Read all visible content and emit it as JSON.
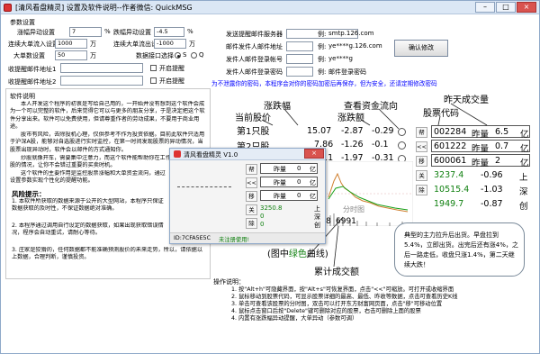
{
  "window": {
    "title": "[清风看盘精灵] 设置及软件说明--作者微信: QuickMSG",
    "min": "–",
    "max": "□",
    "close": "×"
  },
  "params": {
    "heading": "参数设置",
    "rows": [
      {
        "label": "涨幅异动设置",
        "value": "7",
        "unit": "%"
      },
      {
        "label": "连续大单流入设置",
        "value": "1000",
        "unit": "万"
      },
      {
        "label": "大单数设置",
        "value": "50",
        "unit": "万"
      }
    ],
    "fall_label": "跌幅异动设置",
    "fall_value": "-4.5",
    "fall_unit": "%",
    "outflow_label": "连续大单流出设置",
    "outflow_value": "-1000",
    "outflow_unit": "万",
    "source_label": "数据接口选择",
    "source_opt1": "S",
    "source_opt2": "Q",
    "mail1_label": "收提醒邮件地址1",
    "mail2_label": "收提醒邮件地址2",
    "alert_label": "开启提醒"
  },
  "mail": {
    "server_label": "发送提醒邮件服务器",
    "server_example_label": "例:",
    "server_example": "smtp.126.com",
    "sender_label": "邮件发件人邮件地址",
    "sender_example_label": "例:",
    "sender_example": "ye****g.126.com",
    "account_label": "发件人邮件登录帐号",
    "account_example_label": "例:",
    "account_example": "ye****g",
    "password_label": "发件人邮件登录密码",
    "password_example_label": "例:",
    "password_example": "邮件登录密码",
    "save_button": "确认修改",
    "notice": "为不泄露你的密码，本程序会对你的密码加密后再保存，但为安全，还请定期修改密码"
  },
  "manual": {
    "heading": "软件说明",
    "para1": "本人开发这个程序的初衷是写给自己用的，一开始并没有想到这个软件会成为一个可以完整的软件，后来觉得它可以与更多的朋友分享，于是决定把这个软件分享出来。软件可以免费使用，但请尊重作者的劳动成果，不要用于商业用途。",
    "para2": "股市有风险，去除投机心理，仅供参考不作为投资依据。目前此软件只适用于沪深A股，能够对自选股进行实时监控，在第一时间发现股票的异动情况，当股票出现异动时，软件会以邮件的方式通知你。",
    "para3": "炒股就像开车，需要集中注意力，而这个软件能帮助你在工作之余了解自选股的情况，让你不会错过重要的买卖时机。",
    "para4": "这个软件的主要作用是监控股票涨幅和大单资金流向，通过设置参数实现个性化的提醒功能。",
    "tips_heading": "风险提示：",
    "tips": [
      "1. 本软件所获取的数据来源于公开的大型网站，本程序只保证数据获取的及时性，不保证数据绝对准确。",
      "2. 本程序通过调用自行设定的数据获取，如果出现获取错误情况，程序会自动重试，请耐心等待。",
      "3. 庄家是狡猾的，任何数据都不能准确预测股价的未来走势，所以，请依据以上数据，合理判断，谨慎投资。"
    ]
  },
  "annotations": {
    "rise": "涨跌幅",
    "price": "当前股价",
    "fund_flow": "查看资金流向",
    "rise_amount": "涨跌额",
    "prev_vol": "昨天成交量",
    "code": "股票代码",
    "buy1": "第1只股",
    "buy2": "第2只股",
    "chart_hint": "分时图",
    "green_line": "(图中",
    "green_word": "绿色",
    "green_tail": "曲线)",
    "cum_vol": "累计成交额",
    "price_label_a": "5988",
    "price_label_b": "6991"
  },
  "left_stocks": [
    {
      "price": "15.07",
      "rise": "-2.87",
      "amount": "-0.29"
    },
    {
      "price": "7.86",
      "rise": "-1.26",
      "amount": "-0.1"
    },
    {
      "price": "8.11",
      "rise": "-1.97",
      "amount": "-0.31"
    }
  ],
  "side_buttons": [
    "帮",
    "<<",
    "移",
    "关",
    "除"
  ],
  "right_stocks": [
    {
      "code": "002284",
      "vol_label": "昨量",
      "vol": "6.5",
      "unit": "亿"
    },
    {
      "code": "601222",
      "vol_label": "昨量",
      "vol": "0.7",
      "unit": "亿"
    },
    {
      "code": "600061",
      "vol_label": "昨量",
      "vol": "2",
      "unit": "亿"
    }
  ],
  "index_rows": [
    {
      "value": "3237.4",
      "change": "-0.96",
      "name": "上"
    },
    {
      "value": "10515.4",
      "change": "-1.03",
      "name": "深"
    },
    {
      "value": "1949.7",
      "change": "-0.87",
      "name": "创"
    }
  ],
  "popup": {
    "title": "清风看盘精灵 V1.0",
    "rows": [
      {
        "label": "昨量",
        "value": "0",
        "unit": "亿"
      },
      {
        "label": "昨量",
        "value": "0",
        "unit": "亿"
      },
      {
        "label": "昨量",
        "value": "0",
        "unit": "亿"
      }
    ],
    "buttons": [
      "帮",
      "<<",
      "移",
      "关",
      "除"
    ],
    "index_vals": [
      "3250.8",
      "0",
      "0"
    ],
    "index_names": [
      "上",
      "深",
      "创"
    ],
    "id_label": "ID:7CFA5E5C",
    "unregistered": "未注册使用!"
  },
  "bubble": {
    "text": "典型的主力拉升后出货。早盘拉到5.4%，立即出货。出完后还有涨4%，之后一路走低，收盘只涨1.4%，第二天继续大跌！"
  },
  "operations": {
    "heading": "操作说明：",
    "lines": [
      "1. 按\"Alt+h\"可隐藏界面，按\"Alt+s\"可恢复界面，点击\"<<\"可缩放。可打开或收缩界面",
      "2. 鼠标移动到股票代码，可显示股票详细的最高、最低、昨收等数据，点击可查看历史K线",
      "3. 单击可查看该股票的分时图，双击可以打开东方财富网页面，点击\"移\"可移动位置",
      "4. 鼠标点击窗口后按\"Delete\"键可删除对应的股票，右击可删除上面的股票",
      "4. 内置有涨跌幅异动提醒，大单异动（参数可调）"
    ]
  },
  "colors": {
    "accent_blue": "#0000ff",
    "alert_red": "#e00000",
    "rise_green": "#108010",
    "titlebar": "#dbe7f5"
  }
}
